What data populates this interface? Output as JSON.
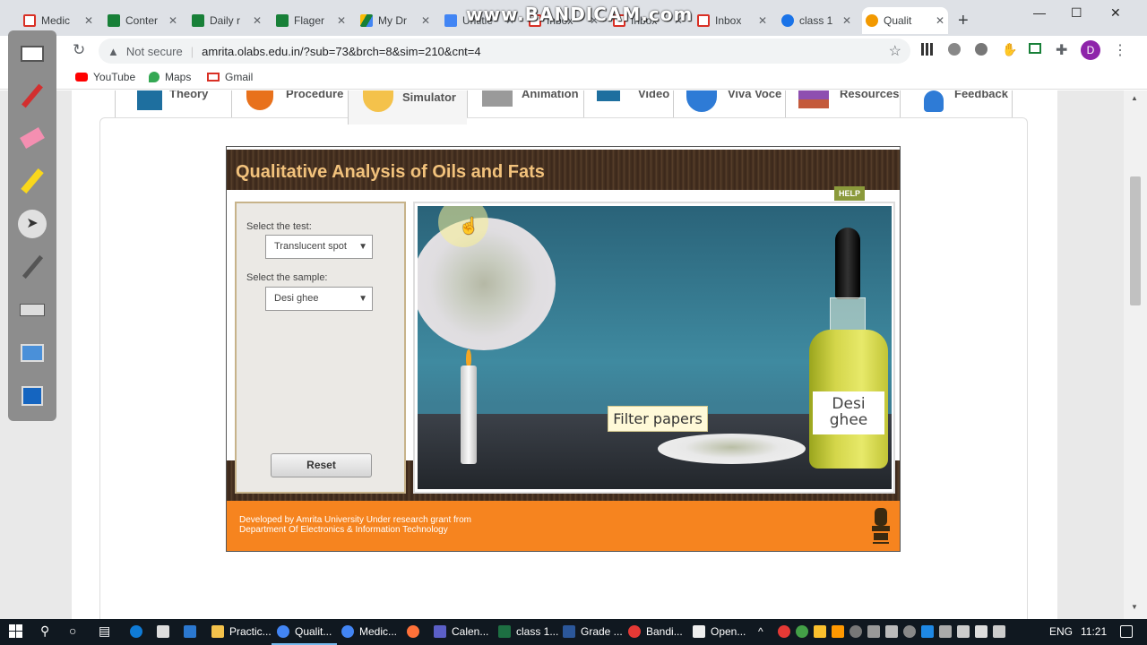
{
  "browser": {
    "tabs": [
      {
        "label": "Medic",
        "color": "#d93025"
      },
      {
        "label": "Conter",
        "color": "#188038"
      },
      {
        "label": "Daily r",
        "color": "#188038"
      },
      {
        "label": "Flager",
        "color": "#188038"
      },
      {
        "label": "My Dr",
        "color": "#fbbc04"
      },
      {
        "label": "Untitle",
        "color": "#4285f4"
      },
      {
        "label": "Inbox",
        "color": "#d93025"
      },
      {
        "label": "Inbox",
        "color": "#d93025"
      },
      {
        "label": "Inbox",
        "color": "#d93025"
      },
      {
        "label": "class 1",
        "color": "#1a73e8"
      },
      {
        "label": "Qualit",
        "color": "#f29900"
      }
    ],
    "watermark": "www.BANDICAM.com",
    "security": "Not secure",
    "url": "amrita.olabs.edu.in/?sub=73&brch=8&sim=210&cnt=4",
    "bookmarks": [
      "YouTube",
      "Maps",
      "Gmail"
    ]
  },
  "nav": {
    "tabs": [
      "Theory",
      "Procedure",
      "Simulator",
      "Animation",
      "Video",
      "Viva Voce",
      "Resources",
      "Feedback"
    ],
    "active": "Simulator"
  },
  "sim": {
    "title": "Qualitative Analysis of Oils and Fats",
    "help": "HELP",
    "test_label": "Select the test:",
    "test_value": "Translucent spot",
    "sample_label": "Select the sample:",
    "sample_value": "Desi ghee",
    "reset": "Reset",
    "filter_label": "Filter papers",
    "bottle_label_1": "Desi",
    "bottle_label_2": "ghee",
    "footer_line1": "Developed by Amrita University Under research grant from",
    "footer_line2": "Department Of Electronics & Information Technology"
  },
  "taskbar": {
    "items": [
      "Practic...",
      "Qualit...",
      "Medic...",
      "Calen...",
      "class 1...",
      "Grade ...",
      "Bandi...",
      "Open..."
    ],
    "lang": "ENG",
    "time": "11:21"
  }
}
